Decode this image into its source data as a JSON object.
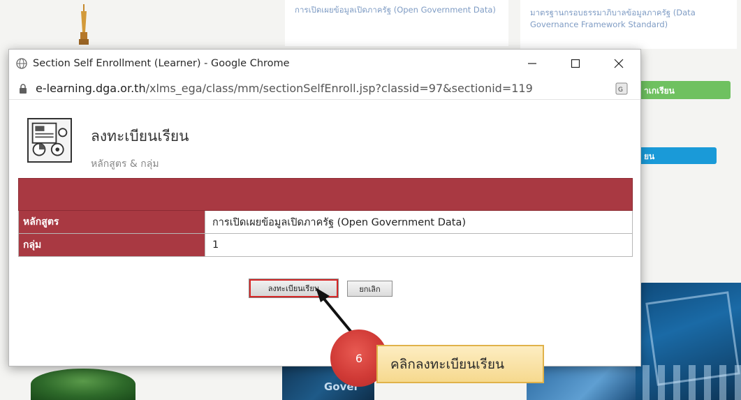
{
  "background": {
    "card_left_text": "การเปิดเผยข้อมูลเปิดภาครัฐ (Open Government Data)",
    "card_right_text": "มาตรฐานกรอบธรรมาภิบาลข้อมูลภาครัฐ (Data Governance Framework Standard)",
    "green_button_label": "าเกเรียน",
    "blue_button_label": "ยน",
    "photo_caption": "Gover"
  },
  "window": {
    "title": "Section Self Enrollment (Learner) - Google Chrome",
    "url_host": "e-learning.dga.or.th",
    "url_path": "/xlms_ega/class/mm/sectionSelfEnroll.jsp?classid=97&sectionid=119",
    "minimize_icon": "minimize-icon",
    "maximize_icon": "maximize-icon",
    "close_icon": "close-icon"
  },
  "page": {
    "title": "ลงทะเบียนเรียน",
    "subtitle": "หลักสูตร & กลุ่ม",
    "rows": [
      {
        "label": "หลักสูตร",
        "value": "การเปิดเผยข้อมูลเปิดภาครัฐ (Open Government Data)"
      },
      {
        "label": "กลุ่ม",
        "value": "1"
      }
    ],
    "enroll_button": "ลงทะเบียนเรียน",
    "cancel_button": "ยกเลิก"
  },
  "annotation": {
    "step_number": "6",
    "callout_text": "คลิกลงทะเบียนเรียน"
  },
  "colors": {
    "table_header": "#a93942",
    "step_circle": "#d03a36",
    "callout_fill": "#f6d98e"
  }
}
